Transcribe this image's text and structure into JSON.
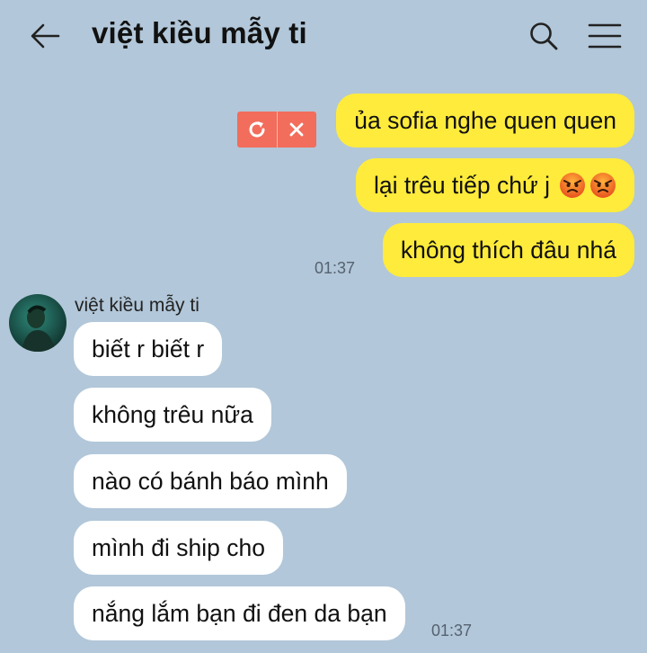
{
  "header": {
    "title": "việt kiều mẫy ti",
    "back_icon": "arrow-left-icon",
    "search_icon": "search-icon",
    "menu_icon": "hamburger-menu-icon"
  },
  "outgoing": [
    {
      "text": "ủa sofia nghe quen quen"
    },
    {
      "text": "lại trêu tiếp chứ j",
      "emojis": [
        "angry-face-emoji",
        "angry-face-emoji"
      ]
    },
    {
      "text": "không thích đâu nhá"
    }
  ],
  "outgoing_time": "01:37",
  "failed_actions": {
    "retry_icon": "retry-icon",
    "delete_icon": "close-icon"
  },
  "incoming": {
    "sender": "việt kiều mẫy ti",
    "messages": [
      {
        "text": "biết r biết r"
      },
      {
        "text": "không trêu nữa"
      },
      {
        "text": "nào có bánh báo mình"
      },
      {
        "text": "mình đi ship cho"
      },
      {
        "text": "nắng lắm bạn đi đen da bạn"
      }
    ],
    "time": "01:37"
  },
  "colors": {
    "background": "#b2c7d9",
    "outgoing_bubble": "#ffeb3b",
    "incoming_bubble": "#ffffff",
    "failed_action": "#f26d5b"
  }
}
